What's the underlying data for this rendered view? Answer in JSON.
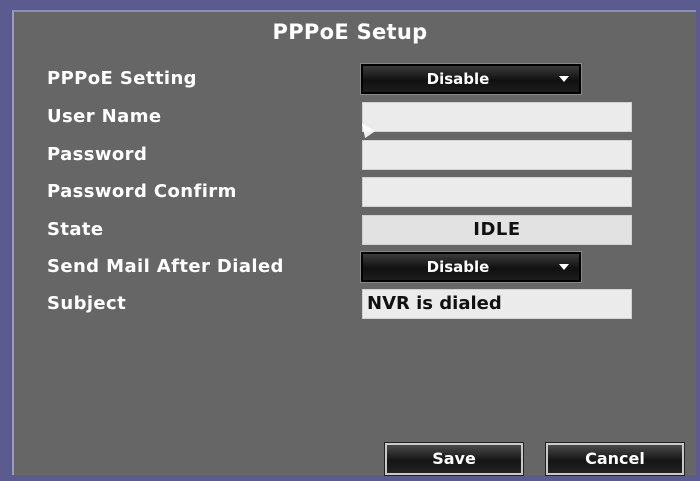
{
  "title": "PPPoE Setup",
  "rows": {
    "pppoe_setting": {
      "label": "PPPoE Setting",
      "value": "Disable"
    },
    "user_name": {
      "label": "User Name",
      "value": ""
    },
    "password": {
      "label": "Password",
      "value": ""
    },
    "password_confirm": {
      "label": "Password Confirm",
      "value": ""
    },
    "state": {
      "label": "State",
      "value": "IDLE"
    },
    "send_mail": {
      "label": "Send Mail After Dialed",
      "value": "Disable"
    },
    "subject": {
      "label": "Subject",
      "value": "NVR is dialed"
    }
  },
  "buttons": {
    "save": "Save",
    "cancel": "Cancel"
  },
  "icons": {
    "dropdown_arrow": "chevron-down-icon",
    "pointer": "mouse-pointer-icon"
  },
  "colors": {
    "background": "#666666",
    "frame": "#5b5b8f",
    "label_text": "#ffffff",
    "field_bg": "#ebebeb"
  }
}
